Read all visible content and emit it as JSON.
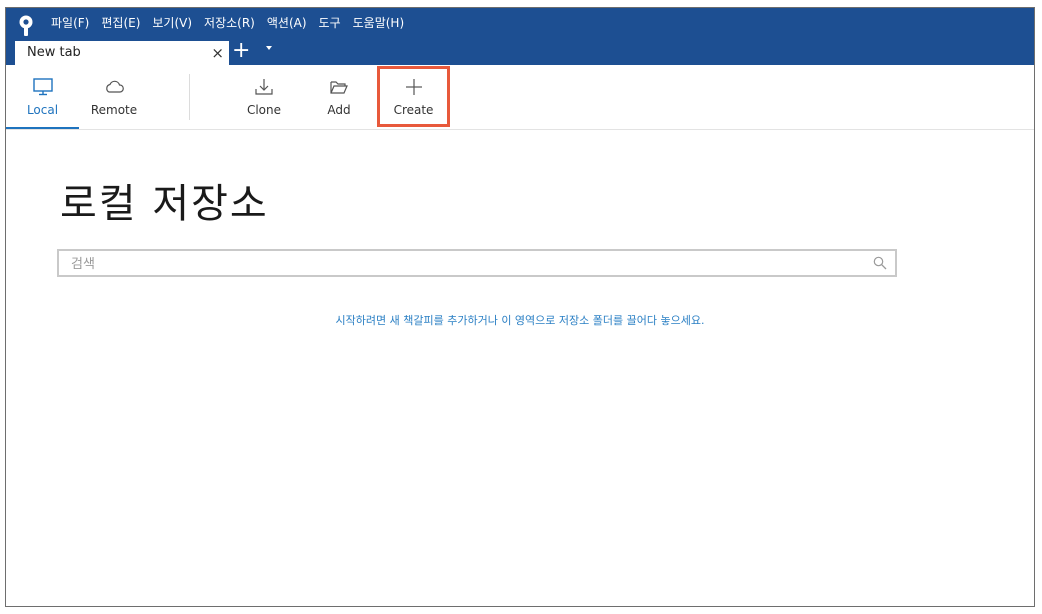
{
  "menubar": {
    "items": [
      "파일(F)",
      "편집(E)",
      "보기(V)",
      "저장소(R)",
      "액션(A)",
      "도구",
      "도움말(H)"
    ]
  },
  "tab": {
    "title": "New tab",
    "close_glyph": "×",
    "add_glyph": "+"
  },
  "toolbar": {
    "local_label": "Local",
    "remote_label": "Remote",
    "clone_label": "Clone",
    "add_label": "Add",
    "create_label": "Create"
  },
  "main": {
    "title": "로컬 저장소",
    "search_placeholder": "검색",
    "hint": "시작하려면 새 책갈피를 추가하거나 이 영역으로 저장소 폴더를 끌어다 놓으세요."
  },
  "colors": {
    "titlebar": "#1d4f92",
    "accent": "#1e73be",
    "highlight": "#e8593b"
  }
}
